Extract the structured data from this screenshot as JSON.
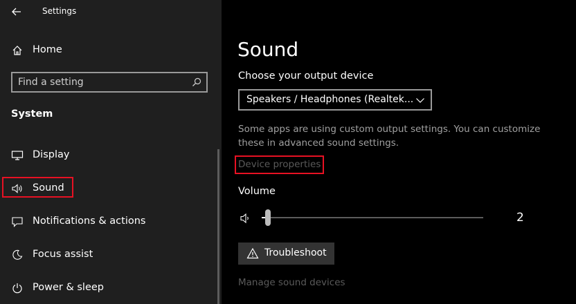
{
  "window": {
    "app_title": "Settings"
  },
  "sidebar": {
    "home_label": "Home",
    "search": {
      "placeholder": "Find a setting"
    },
    "section_heading": "System",
    "items": [
      {
        "label": "Display",
        "icon": "monitor-icon"
      },
      {
        "label": "Sound",
        "icon": "speaker-icon",
        "selected": true
      },
      {
        "label": "Notifications & actions",
        "icon": "notification-icon"
      },
      {
        "label": "Focus assist",
        "icon": "moon-icon"
      },
      {
        "label": "Power & sleep",
        "icon": "power-icon"
      }
    ]
  },
  "main": {
    "title": "Sound",
    "output": {
      "label": "Choose your output device",
      "selected_device": "Speakers / Headphones (Realtek..."
    },
    "info_text": "Some apps are using custom output settings. You can customize these in advanced sound settings.",
    "device_properties_link": "Device properties",
    "volume": {
      "label": "Volume",
      "value": "2",
      "level_percent": 2
    },
    "troubleshoot_label": "Troubleshoot",
    "manage_devices_link": "Manage sound devices"
  },
  "colors": {
    "sidebar_bg": "#1f1f1f",
    "main_bg": "#000000",
    "highlight_red": "#e81123",
    "disabled_text": "#5a5a5a",
    "secondary_text": "#a0a0a0",
    "button_bg": "#333333"
  }
}
